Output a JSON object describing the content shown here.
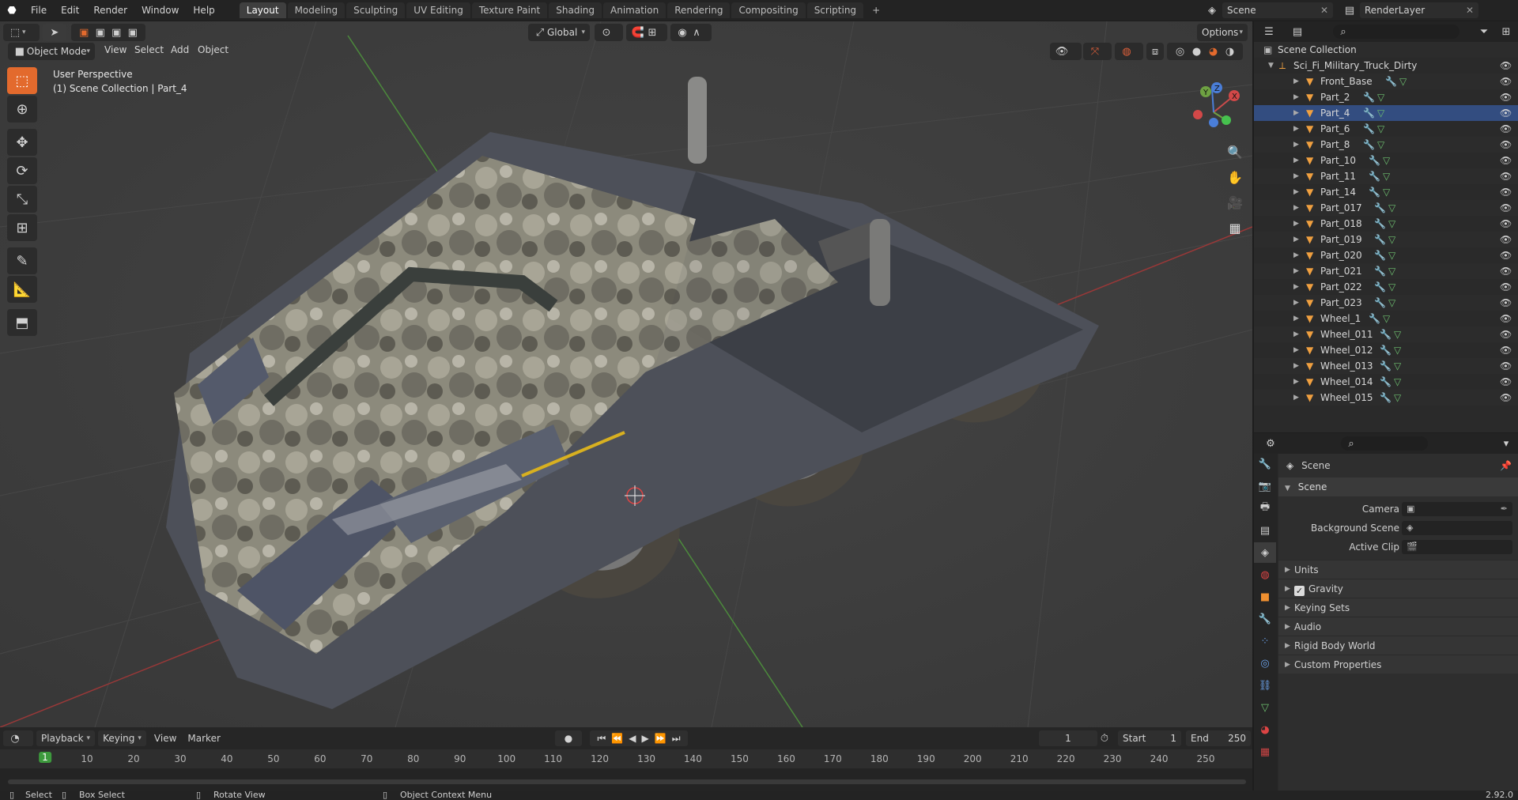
{
  "app": {
    "version": "2.92.0"
  },
  "topbar": {
    "menus": [
      "File",
      "Edit",
      "Render",
      "Window",
      "Help"
    ],
    "workspaces": [
      "Layout",
      "Modeling",
      "Sculpting",
      "UV Editing",
      "Texture Paint",
      "Shading",
      "Animation",
      "Rendering",
      "Compositing",
      "Scripting"
    ],
    "active_workspace": "Layout",
    "add_tab": "+",
    "scene_name": "Scene",
    "view_layer": "RenderLayer"
  },
  "viewport": {
    "mode": "Object Mode",
    "menus": [
      "View",
      "Select",
      "Add",
      "Object"
    ],
    "transform_orientation": "Global",
    "options_label": "Options",
    "perspective_label": "User Perspective",
    "collection_label": "(1) Scene Collection | Part_4",
    "gizmo_axes": [
      "X",
      "Y",
      "Z"
    ]
  },
  "toolbar": {
    "tools": [
      "select-box-icon",
      "cursor-icon",
      "move-icon",
      "rotate-icon",
      "scale-icon",
      "transform-icon",
      "annotate-icon",
      "measure-icon",
      "add-cube-icon"
    ]
  },
  "outliner": {
    "root": "Scene Collection",
    "collection": "Sci_Fi_Military_Truck_Dirty",
    "objects": [
      "Front_Base",
      "Part_2",
      "Part_4",
      "Part_6",
      "Part_8",
      "Part_10",
      "Part_11",
      "Part_14",
      "Part_017",
      "Part_018",
      "Part_019",
      "Part_020",
      "Part_021",
      "Part_022",
      "Part_023",
      "Wheel_1",
      "Wheel_011",
      "Wheel_012",
      "Wheel_013",
      "Wheel_014",
      "Wheel_015"
    ],
    "selected_object": "Part_4"
  },
  "properties": {
    "context_title": "Scene",
    "section": "Scene",
    "fields": [
      {
        "label": "Camera",
        "value": ""
      },
      {
        "label": "Background Scene",
        "value": ""
      },
      {
        "label": "Active Clip",
        "value": ""
      }
    ],
    "panels": [
      "Units",
      "Gravity",
      "Keying Sets",
      "Audio",
      "Rigid Body World",
      "Custom Properties"
    ],
    "gravity_checked": true
  },
  "timeline": {
    "menus": [
      "Playback",
      "Keying",
      "View",
      "Marker"
    ],
    "current_frame": "1",
    "start_label": "Start",
    "start": "1",
    "end_label": "End",
    "end": "250",
    "ticks": [
      "1",
      "10",
      "20",
      "30",
      "40",
      "50",
      "60",
      "70",
      "80",
      "90",
      "100",
      "110",
      "120",
      "130",
      "140",
      "150",
      "160",
      "170",
      "180",
      "190",
      "200",
      "210",
      "220",
      "230",
      "240",
      "250"
    ]
  },
  "statusbar": {
    "items": [
      "Select",
      "Box Select",
      "Rotate View",
      "Object Context Menu"
    ]
  },
  "colors": {
    "accent": "#e36a2d",
    "selection": "#334d80",
    "frame_marker": "#3d9a3d"
  }
}
